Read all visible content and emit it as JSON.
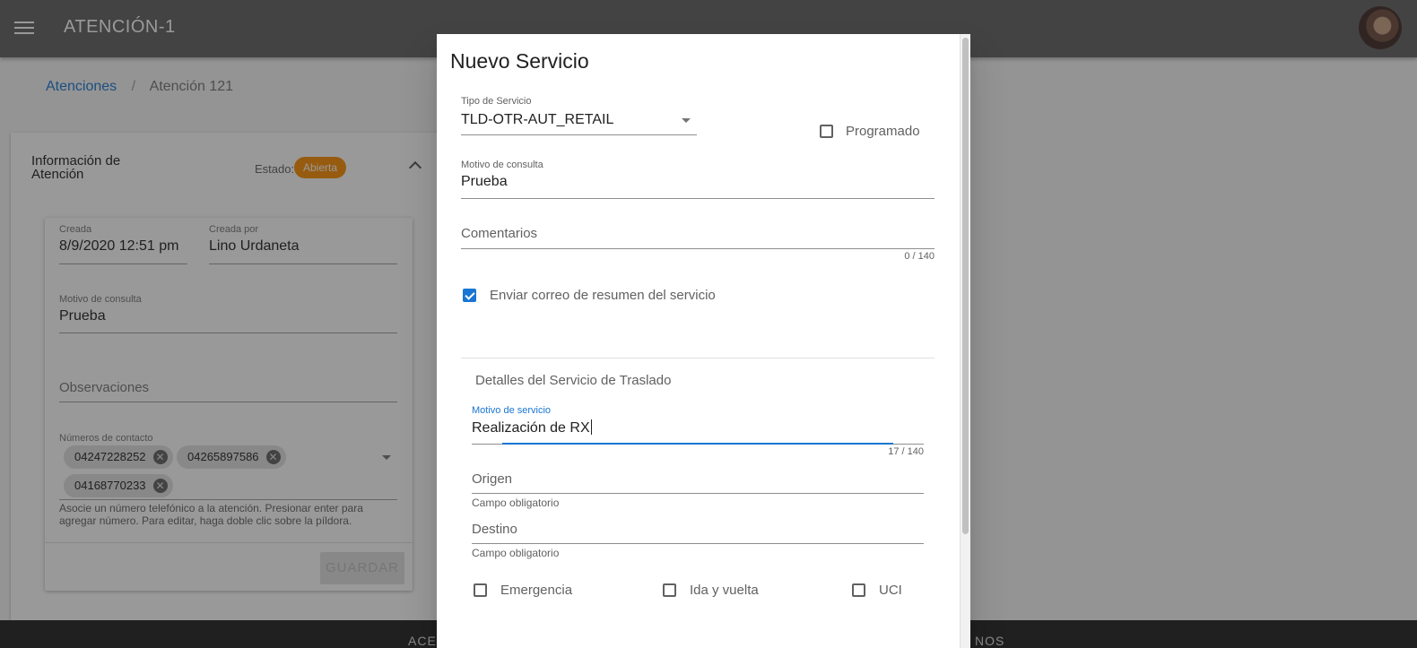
{
  "appbar": {
    "title": "ATENCIÓN-1",
    "avatar_icon": "user-avatar"
  },
  "breadcrumb": {
    "parent": "Atenciones",
    "separator": "/",
    "current": "Atención 121"
  },
  "info_card": {
    "title": "Información de Atención",
    "estado_label": "Estado:",
    "estado_value": "Abierta",
    "estado_color": "#fb8c00",
    "created_label": "Creada",
    "created_value": "8/9/2020 12:51 pm",
    "created_by_label": "Creada por",
    "created_by_value": "Lino Urdaneta",
    "motivo_label": "Motivo de consulta",
    "motivo_value": "Prueba",
    "observaciones_placeholder": "Observaciones",
    "contact_label": "Números de contacto",
    "contacts": [
      "04247228252",
      "04265897586",
      "04168770233"
    ],
    "contact_hint": "Asocie un número telefónico a la atención. Presionar enter para agregar número. Para editar, haga doble clic sobre la píldora.",
    "save_label": "GUARDAR"
  },
  "footer": {
    "left_text": "ACE",
    "right_text": "NOS"
  },
  "dialog": {
    "title": "Nuevo Servicio",
    "tipo_label": "Tipo de Servicio",
    "tipo_value": "TLD-OTR-AUT_RETAIL",
    "programado_label": "Programado",
    "programado_checked": false,
    "motivo_label": "Motivo de consulta",
    "motivo_value": "Prueba",
    "comentarios_placeholder": "Comentarios",
    "comentarios_counter": "0 / 140",
    "email_label": "Enviar correo de resumen del servicio",
    "email_checked": true,
    "section_title": "Detalles del Servicio de Traslado",
    "motivo_servicio_label": "Motivo de servicio",
    "motivo_servicio_value": "Realización de RX",
    "motivo_servicio_counter": "17 / 140",
    "origen_placeholder": "Origen",
    "origen_help": "Campo obligatorio",
    "destino_placeholder": "Destino",
    "destino_help": "Campo obligatorio",
    "emergencia_label": "Emergencia",
    "ida_vuelta_label": "Ida y vuelta",
    "uci_label": "UCI",
    "accent_color": "#1976d2"
  }
}
